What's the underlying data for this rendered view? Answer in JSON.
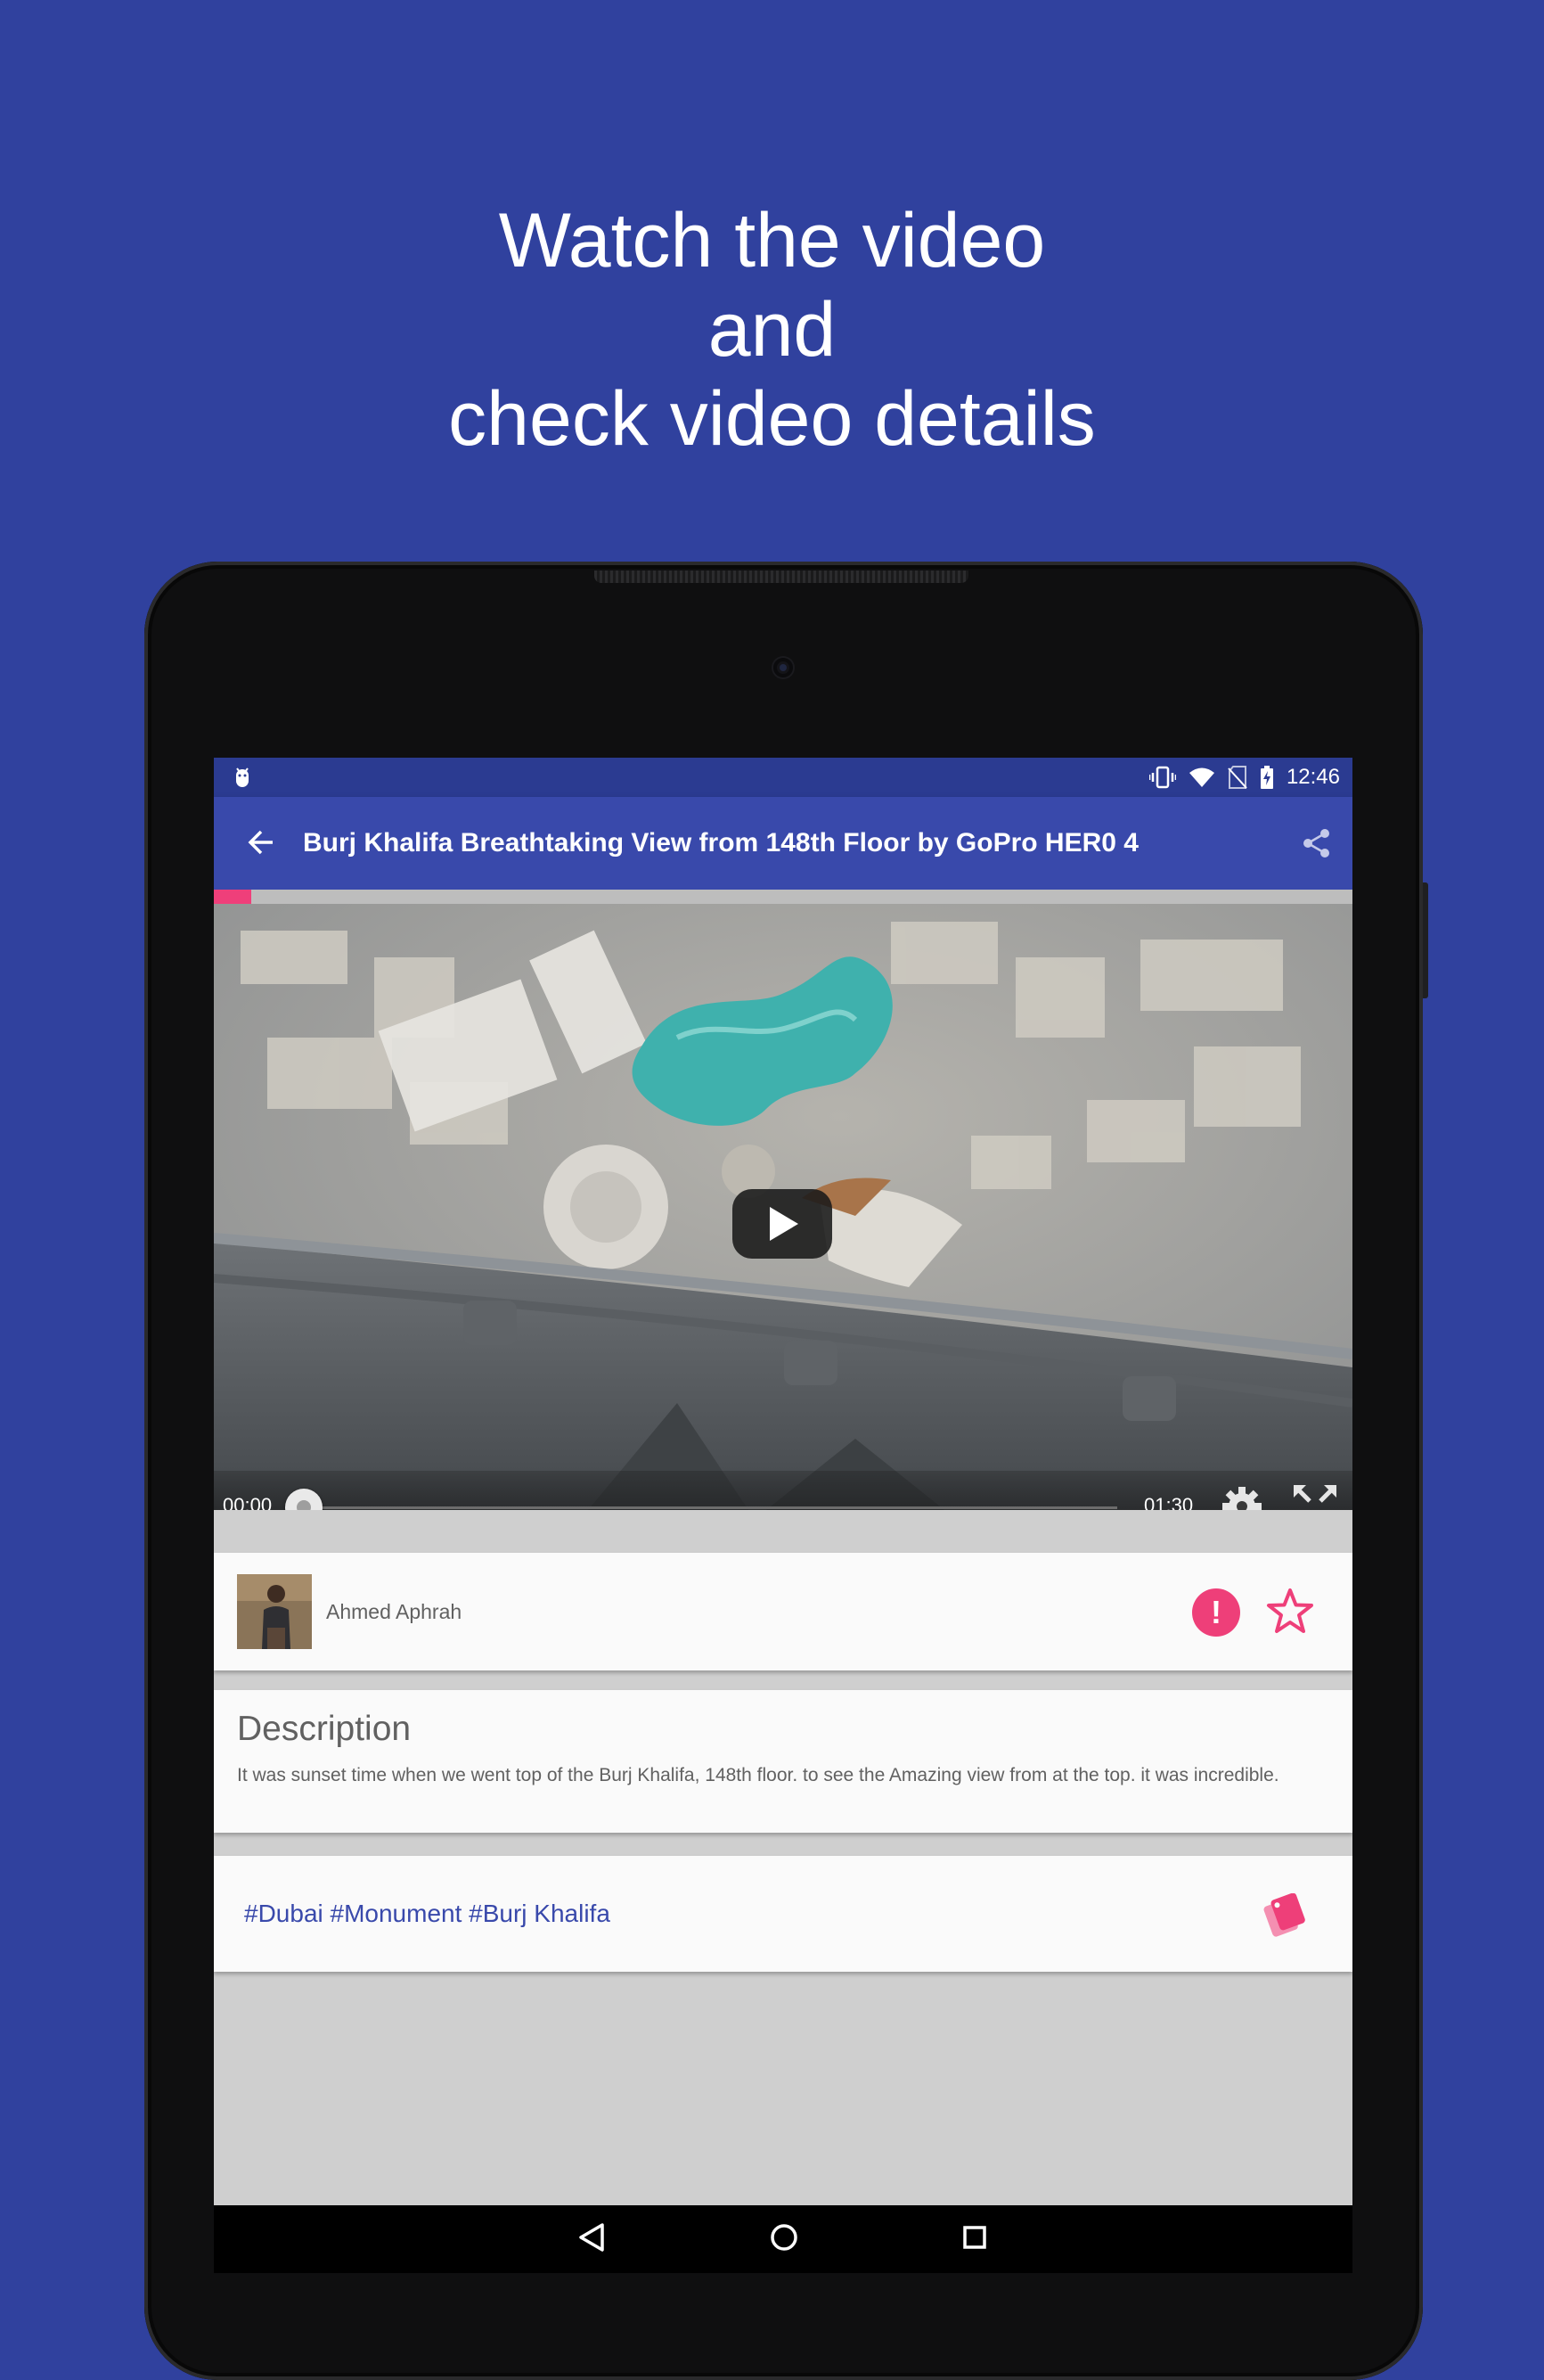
{
  "headline": {
    "line1": "Watch the video",
    "line2": "and",
    "line3": "check video details"
  },
  "status_bar": {
    "time": "12:46",
    "icons": [
      "android-debug-icon",
      "vibrate-icon",
      "wifi-icon",
      "no-sim-icon",
      "battery-charging-icon"
    ]
  },
  "app_bar": {
    "title": "Burj Khalifa Breathtaking View from 148th Floor by GoPro HER0 4",
    "back_icon": "arrow-back-icon",
    "share_icon": "share-icon"
  },
  "player": {
    "current_time": "00:00",
    "duration": "01:30",
    "progress_fraction": 0.0,
    "buffer_fraction": 0.05,
    "play_icon": "play-icon",
    "settings_icon": "gear-icon",
    "fullscreen_icon": "fullscreen-icon"
  },
  "author": {
    "name": "Ahmed Aphrah",
    "report_icon": "exclamation-icon",
    "favorite_icon": "star-outline-icon"
  },
  "description": {
    "title": "Description",
    "text": "It was sunset time when we went top of the Burj Khalifa, 148th floor. to see the Amazing view from at the top. it was incredible."
  },
  "tags": {
    "text": "#Dubai #Monument #Burj Khalifa",
    "icon": "tags-icon"
  },
  "colors": {
    "background": "#30419e",
    "app_bar": "#3949ab",
    "accent": "#ee3f79",
    "tag_text": "#3949ab"
  }
}
